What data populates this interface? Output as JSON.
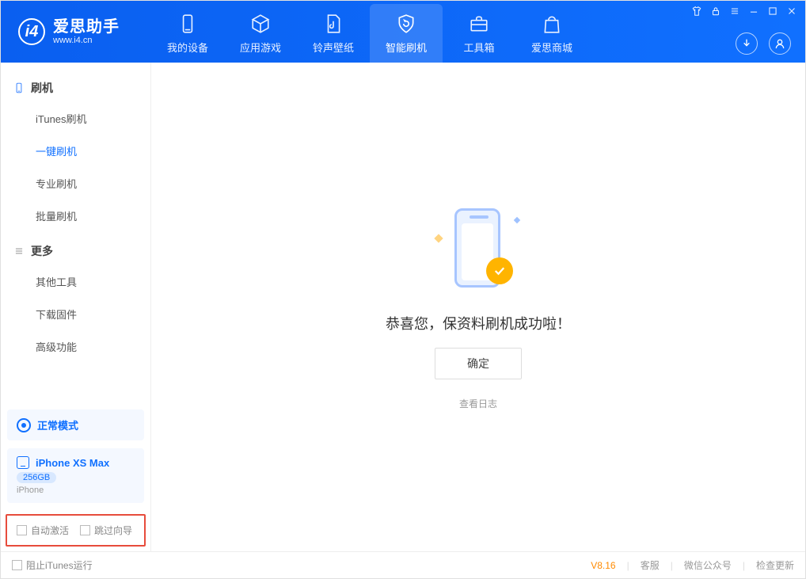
{
  "app": {
    "title": "爱思助手",
    "url": "www.i4.cn"
  },
  "tabs": {
    "device": "我的设备",
    "apps": "应用游戏",
    "ringtones": "铃声壁纸",
    "flash": "智能刷机",
    "toolbox": "工具箱",
    "store": "爱思商城"
  },
  "sidebar": {
    "group1": "刷机",
    "items1": {
      "itunes": "iTunes刷机",
      "onekey": "一键刷机",
      "pro": "专业刷机",
      "batch": "批量刷机"
    },
    "group2": "更多",
    "items2": {
      "other": "其他工具",
      "download": "下载固件",
      "advanced": "高级功能"
    },
    "mode_label": "正常模式",
    "device": {
      "name": "iPhone XS Max",
      "storage": "256GB",
      "type": "iPhone"
    },
    "checkbox1": "自动激活",
    "checkbox2": "跳过向导"
  },
  "main": {
    "success": "恭喜您，保资料刷机成功啦！",
    "ok": "确定",
    "view_log": "查看日志"
  },
  "status": {
    "block_itunes": "阻止iTunes运行",
    "version": "V8.16",
    "cs": "客服",
    "wechat": "微信公众号",
    "update": "检查更新"
  }
}
